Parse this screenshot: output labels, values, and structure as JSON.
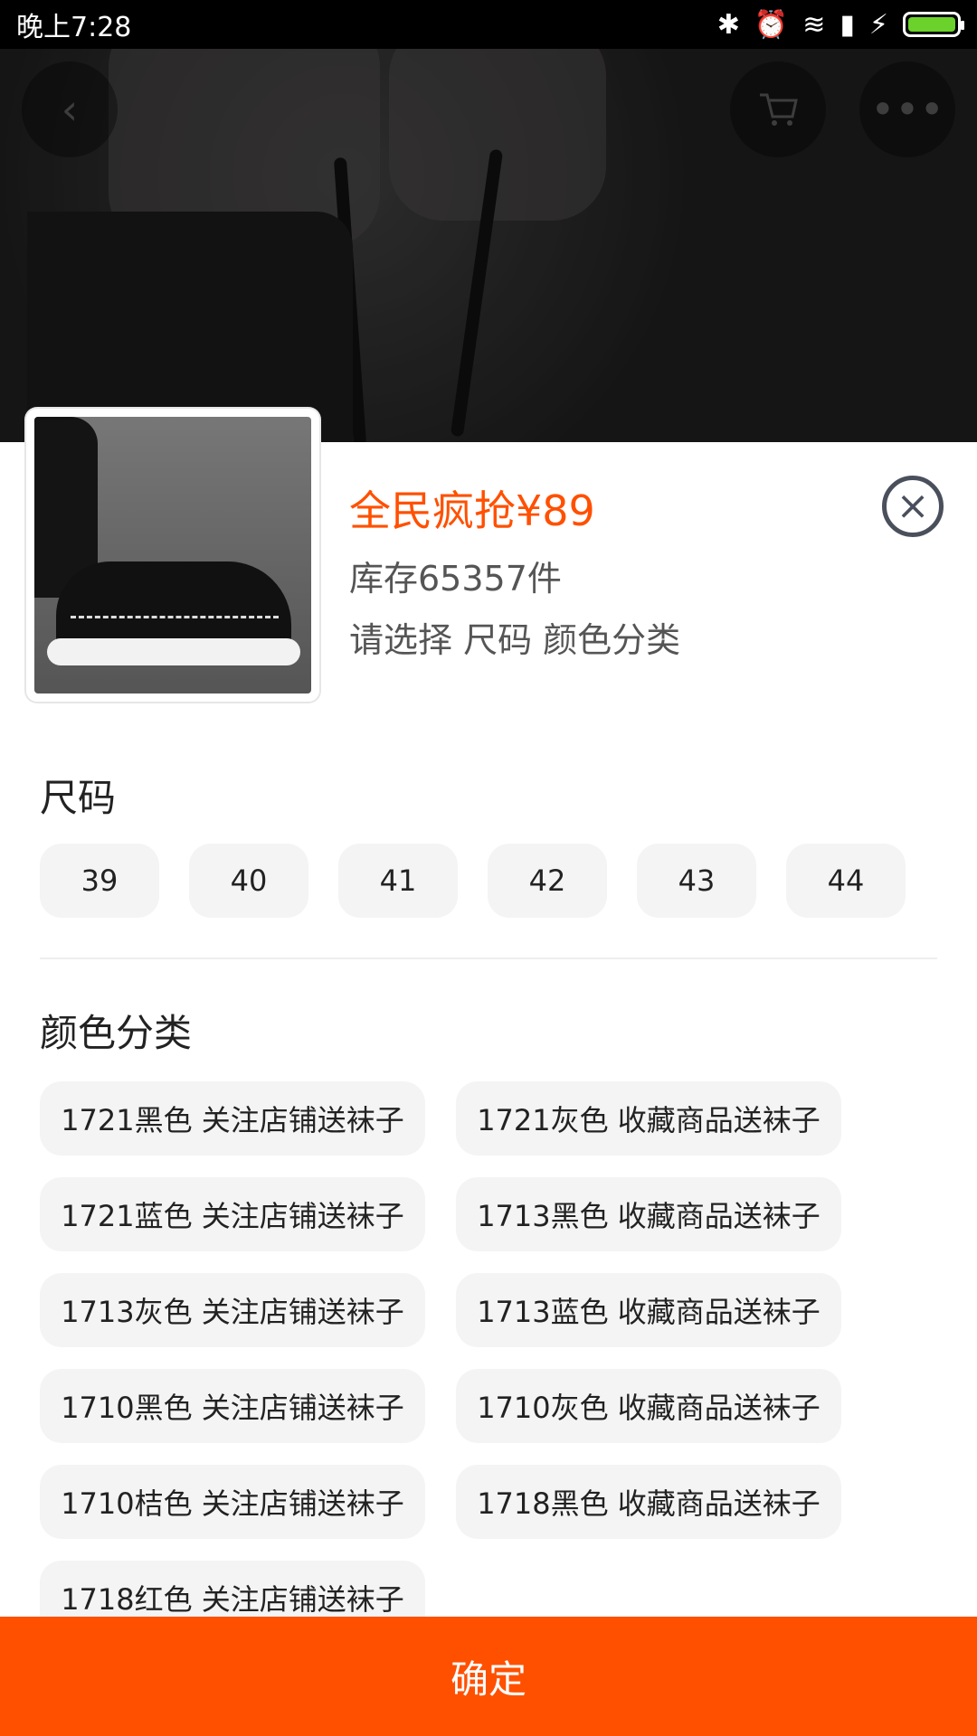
{
  "status_bar": {
    "time": "晚上7:28"
  },
  "product": {
    "price": "全民疯抢¥89",
    "stock": "库存65357件",
    "select_hint": "请选择 尺码 颜色分类"
  },
  "size": {
    "title": "尺码",
    "options": [
      "39",
      "40",
      "41",
      "42",
      "43",
      "44"
    ]
  },
  "color": {
    "title": "颜色分类",
    "options": [
      "1721黑色 关注店铺送袜子",
      "1721灰色 收藏商品送袜子",
      "1721蓝色 关注店铺送袜子",
      "1713黑色 收藏商品送袜子",
      "1713灰色 关注店铺送袜子",
      "1713蓝色 收藏商品送袜子",
      "1710黑色 关注店铺送袜子",
      "1710灰色 收藏商品送袜子",
      "1710桔色 关注店铺送袜子",
      "1718黑色 收藏商品送袜子",
      "1718红色 关注店铺送袜子"
    ]
  },
  "footer": {
    "confirm_label": "确定"
  },
  "icons": {
    "back": "back-arrow-icon",
    "cart": "cart-icon",
    "more": "more-icon",
    "close": "close-icon"
  },
  "colors": {
    "accent": "#ff5000",
    "chip_bg": "#f4f4f4"
  }
}
